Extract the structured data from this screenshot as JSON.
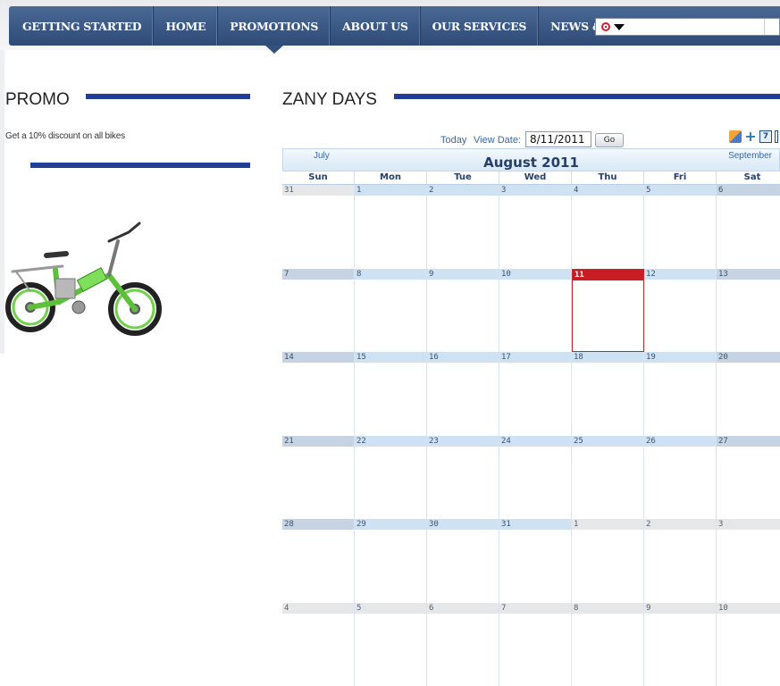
{
  "nav": {
    "items": [
      "GETTING STARTED",
      "HOME",
      "PROMOTIONS",
      "ABOUT US",
      "OUR SERVICES",
      "NEWS & PROMOTIONS"
    ],
    "active": "PROMOTIONS"
  },
  "promo": {
    "heading": "PROMO",
    "text": "Get a 10% discount on all bikes"
  },
  "calendar": {
    "heading": "ZANY DAYS",
    "today_label": "Today",
    "view_date_label": "View Date:",
    "view_date_value": "8/11/2011",
    "go_label": "Go",
    "prev_month": "July",
    "next_month": "September",
    "month_title": "August 2011",
    "days_of_week": [
      "Sun",
      "Mon",
      "Tue",
      "Wed",
      "Thu",
      "Fri",
      "Sat"
    ],
    "weeks": [
      [
        "31",
        "1",
        "2",
        "3",
        "4",
        "5",
        "6"
      ],
      [
        "7",
        "8",
        "9",
        "10",
        "11",
        "12",
        "13"
      ],
      [
        "14",
        "15",
        "16",
        "17",
        "18",
        "19",
        "20"
      ],
      [
        "21",
        "22",
        "23",
        "24",
        "25",
        "26",
        "27"
      ],
      [
        "28",
        "29",
        "30",
        "31",
        "1",
        "2",
        "3"
      ],
      [
        "4",
        "5",
        "6",
        "7",
        "8",
        "9",
        "10"
      ]
    ],
    "today_date": "11",
    "toolbar_seven": "7"
  },
  "colors": {
    "nav_bg": "#34507c",
    "accent_bar": "#213f96",
    "today": "#c81d25",
    "link": "#3a66a8"
  }
}
